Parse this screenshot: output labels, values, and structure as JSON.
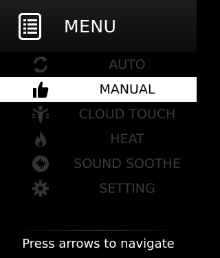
{
  "header": {
    "title": "MENU",
    "icon": "menu-list-icon"
  },
  "menu": {
    "items": [
      {
        "label": "AUTO",
        "icon": "auto-cycle-icon",
        "selected": false
      },
      {
        "label": "MANUAL",
        "icon": "hand-thumbs-up-icon",
        "selected": true
      },
      {
        "label": "CLOUD TOUCH",
        "icon": "body-massage-icon",
        "selected": false
      },
      {
        "label": "HEAT",
        "icon": "flame-icon",
        "selected": false
      },
      {
        "label": "SOUND SOOTHE",
        "icon": "sound-wave-icon",
        "selected": false
      },
      {
        "label": "SETTING",
        "icon": "gear-icon",
        "selected": false
      }
    ]
  },
  "footer": {
    "hint": "Press arrows to navigate"
  },
  "colors": {
    "background": "#000000",
    "selected_background": "#ffffff",
    "inactive_text": "#3a3a3a",
    "inactive_icon": "#333333"
  }
}
